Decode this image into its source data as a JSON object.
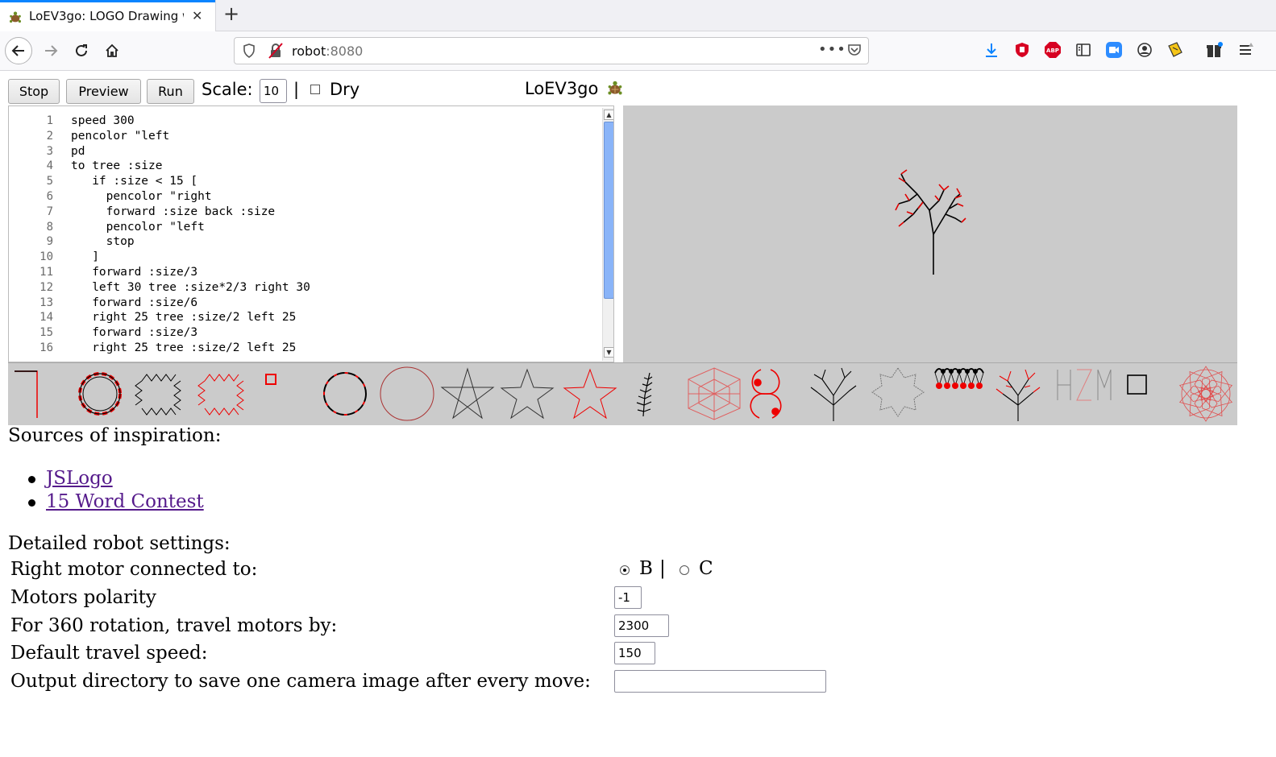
{
  "browser": {
    "tab_title": "LoEV3go: LOGO Drawing w",
    "url_host": "robot",
    "url_port": ":8080",
    "more_label": "•••",
    "accent_color": "#0a84ff"
  },
  "toolbar": {
    "stop_label": "Stop",
    "preview_label": "Preview",
    "run_label": "Run",
    "scale_label": "Scale:",
    "scale_value": "10",
    "separator": "|",
    "dry_label": "Dry",
    "dry_checked": false,
    "app_title": "LoEV3go"
  },
  "editor": {
    "line_numbers": "1\n2\n3\n4\n5\n6\n7\n8\n9\n10\n11\n12\n13\n14\n15\n16",
    "code": "speed 300\npencolor \"left\npd\nto tree :size\n   if :size < 15 [\n     pencolor \"right\n     forward :size back :size\n     pencolor \"left\n     stop\n   ]\n   forward :size/3\n   left 30 tree :size*2/3 right 30\n   forward :size/6\n   right 25 tree :size/2 left 25\n   forward :size/3\n   right 25 tree :size/2 left 25"
  },
  "gallery": {
    "items": [
      "line",
      "bead-ring",
      "zigzag-square",
      "zigzag-square-red",
      "small-square",
      "dashed-circle",
      "circle",
      "pentagram",
      "star-outline",
      "star-red",
      "fern",
      "polygon-rosette",
      "spiral-pair",
      "tree",
      "snowflake",
      "loops-row",
      "tree-color",
      "letters-hzm",
      "square",
      "red-rosette"
    ]
  },
  "inspiration": {
    "title": "Sources of inspiration:",
    "links": [
      "JSLogo",
      "15 Word Contest"
    ]
  },
  "settings": {
    "title": "Detailed robot settings:",
    "right_motor_label": "Right motor connected to:",
    "motor_option_b": "B",
    "motor_separator": "|",
    "motor_option_c": "C",
    "selected_motor": "B",
    "polarity_label": "Motors polarity",
    "polarity_value": "-1",
    "rotation_label": "For 360 rotation, travel motors by:",
    "rotation_value": "2300",
    "speed_label": "Default travel speed:",
    "speed_value": "150",
    "output_dir_label": "Output directory to save one camera image after every move:",
    "output_dir_value": ""
  }
}
